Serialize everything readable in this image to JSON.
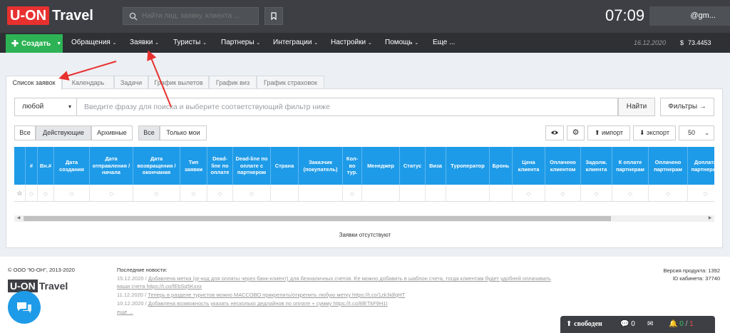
{
  "header": {
    "logo_box": "U-ON",
    "logo_text": "Travel",
    "search_placeholder": "Найти лид, заявку, клиента ...",
    "clock": "07:09",
    "user": "@gm..."
  },
  "nav": {
    "create": "Создать",
    "items": [
      "Обращения",
      "Заявки",
      "Туристы",
      "Партнеры",
      "Интеграции",
      "Настройки",
      "Помощь",
      "Еще ..."
    ],
    "date": "16.12.2020",
    "balance": "73.4453",
    "currency": "$"
  },
  "tabs": [
    "Список заявок",
    "Календарь",
    "Задачи",
    "График вылетов",
    "График виз",
    "График страховок"
  ],
  "filter": {
    "select_value": "любой",
    "input_placeholder": "Введите фразу для поиска и выберите соответствующий фильтр ниже",
    "find": "Найти",
    "filters": "Фильтры →"
  },
  "segments": {
    "status": [
      "Все",
      "Действующие",
      "Архивные"
    ],
    "owner": [
      "Все",
      "Только мои"
    ]
  },
  "toolbar": {
    "import": "импорт",
    "export": "экспорт",
    "per_page": "50"
  },
  "table": {
    "columns": [
      "#",
      "Вн.#",
      "Дата создания",
      "Дата отправления / начала",
      "Дата возвращения / окончания",
      "Тип заявки",
      "Dead-line по оплате",
      "Dead-line по оплате с партнером",
      "Страна",
      "Заказчик (покупатель)",
      "Кол-во тур.",
      "Менеджер",
      "Статус",
      "Виза",
      "Туроператор",
      "Бронь",
      "Цена клиента",
      "Оплачено клиентом",
      "Задолж. клиента",
      "К оплате партнерам",
      "Оплачено партнерам",
      "Доплата партнерам"
    ],
    "empty": "Заявки отсутствуют"
  },
  "footer": {
    "copyright": "© ООО \"Ю-ОН\", 2013-2020",
    "news_title": "Последние новости:",
    "news": [
      {
        "date": "15.12.2020 / ",
        "text": "Добавлена метка (qr-код для оплаты через банк-клиент) для безналичных счетов. Ее можно добавить в шаблон счета, тогда клиентам будет удобней оплачивать"
      },
      {
        "date": "",
        "text": "ваши счета https://t.co/fEbSq5Kxxx"
      },
      {
        "date": "11.12.2020 / ",
        "text": "Теперь в разделе туристов можно МАССОВО прикрепить/открепить любую метку https://t.co/1zk3idlqHT"
      },
      {
        "date": "10.12.2020 / ",
        "text": "Добавлена возможность указать несколько дедлайнов по оплате + сумму https://t.co/8lETkF9H1I"
      },
      {
        "date": "",
        "text": "еще ..."
      }
    ],
    "version": "Версия продукта: 1392",
    "cabinet": "ID кабинета: 37740"
  },
  "status_bar": {
    "state": "свободен",
    "chats": "0",
    "online": "0",
    "total": "1"
  }
}
